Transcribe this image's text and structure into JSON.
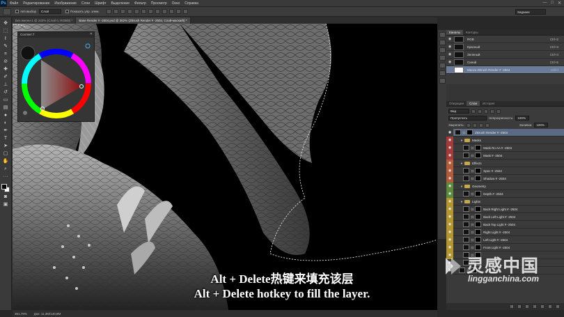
{
  "app": {
    "logo": "Ps"
  },
  "menu": [
    "Файл",
    "Редактирование",
    "Изображение",
    "Слои",
    "Шрифт",
    "Выделение",
    "Фильтр",
    "Просмотр",
    "Окно",
    "Справка"
  ],
  "window_controls": [
    "—",
    "□",
    "✕"
  ],
  "options": {
    "autoselect_label": "Автовыбор",
    "autoselect_target": "Слой",
    "show_controls_label": "Показать упр. элем.",
    "workspace": "Sagaaas"
  },
  "tabs": [
    {
      "label": "Без имени-1 @ 242% (Слой 0, RGB/8) *"
    },
    {
      "label": "Base Render # -2504.psd @ 362% (ZBrush Render # -2504, Слой-маска/8) *"
    }
  ],
  "color_panel": {
    "title": "Соответ.Т"
  },
  "status": {
    "zoom": "361,79%",
    "doc": "Док: 11,3M/140,8M"
  },
  "channels_panel": {
    "tabs": [
      "Каналы",
      "Контуры"
    ],
    "rows": [
      {
        "name": "RGB",
        "key": "Ctrl+2"
      },
      {
        "name": "Красный",
        "key": "Ctrl+3"
      },
      {
        "name": "Зеленый",
        "key": "Ctrl+4"
      },
      {
        "name": "Синий",
        "key": "Ctrl+5"
      },
      {
        "name": "Маска ZBrush Render # -2504",
        "key": "Ctrl+\\"
      }
    ]
  },
  "layers_panel": {
    "tabs": [
      "Операции",
      "Слои",
      "История"
    ],
    "kind_select": "Вид",
    "blend_mode": "Пропустить",
    "opacity_label": "Непрозрачность:",
    "opacity_value": "100%",
    "lock_label": "Закрепить:",
    "fill_label": "Заливка:",
    "fill_value": "100%",
    "rows": [
      {
        "name": "ZBrush Render # -2504",
        "type": "layer",
        "indent": 0,
        "color": "#3a3a3a",
        "selected": true
      },
      {
        "name": "Masks",
        "type": "group",
        "indent": 1,
        "color": "#a63a3a"
      },
      {
        "name": "Mask Ro AA # -2504",
        "type": "layer",
        "indent": 2,
        "color": "#a63a3a"
      },
      {
        "name": "Mask # -2504",
        "type": "layer",
        "indent": 2,
        "color": "#a63a3a"
      },
      {
        "name": "Effects",
        "type": "group",
        "indent": 1,
        "color": "#b35a3a"
      },
      {
        "name": "Spec # -2504",
        "type": "layer",
        "indent": 2,
        "color": "#b35a3a"
      },
      {
        "name": "Shadow # -2504",
        "type": "layer",
        "indent": 2,
        "color": "#b35a3a"
      },
      {
        "name": "Geometry",
        "type": "group",
        "indent": 1,
        "color": "#5b8a3c"
      },
      {
        "name": "Depth # -2504",
        "type": "layer",
        "indent": 2,
        "color": "#5b8a3c"
      },
      {
        "name": "Lights",
        "type": "group",
        "indent": 1,
        "color": "#b3962e"
      },
      {
        "name": "Back Right Light # -2504",
        "type": "layer",
        "indent": 2,
        "color": "#b3962e"
      },
      {
        "name": "Back Left Light # -2504",
        "type": "layer",
        "indent": 2,
        "color": "#b3962e"
      },
      {
        "name": "Back Top Light # -2504",
        "type": "layer",
        "indent": 2,
        "color": "#b3962e"
      },
      {
        "name": "Right Light # -2504",
        "type": "layer",
        "indent": 2,
        "color": "#b3962e"
      },
      {
        "name": "Left Light # -2504",
        "type": "layer",
        "indent": 2,
        "color": "#b3962e"
      },
      {
        "name": "Front Light # -2504",
        "type": "layer",
        "indent": 2,
        "color": "#b3962e"
      },
      {
        "name": "",
        "type": "layer",
        "indent": 2,
        "color": "#b3962e"
      },
      {
        "name": "",
        "type": "layer",
        "indent": 2,
        "color": "#3a3a3a"
      },
      {
        "name": "",
        "type": "layer",
        "indent": 1,
        "color": "#3a3a3a"
      }
    ]
  },
  "subtitle": {
    "cn": "Alt + Delete热键来填充该层",
    "en": "Alt + Delete hotkey to fill the layer."
  },
  "watermark": {
    "cn": "灵感中国",
    "url": "lingganchina.com"
  },
  "icons": {
    "eye": "eye-icon",
    "folder": "folder-icon",
    "chain": "link-icon"
  }
}
